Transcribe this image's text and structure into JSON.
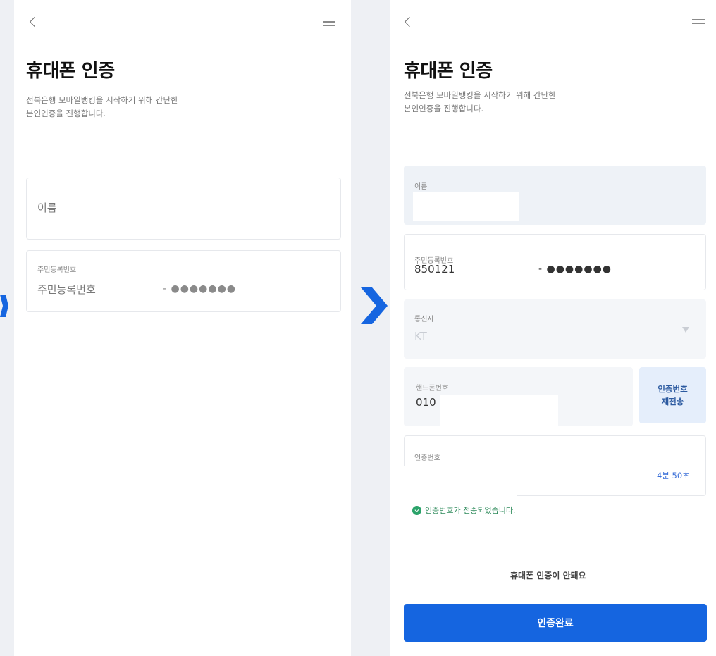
{
  "left": {
    "title": "휴대폰 인증",
    "description_line1": "전북은행 모바일뱅킹을 시작하기 위해 간단한",
    "description_line2": "본인인증을 진행합니다.",
    "name_placeholder": "이름",
    "rrn_label": "주민등록번호",
    "rrn_placeholder": "주민등록번호",
    "rrn_mask": "- ●●●●●●●"
  },
  "right": {
    "title": "휴대폰 인증",
    "description_line1": "전북은행 모바일뱅킹을 시작하기 위해 간단한",
    "description_line2": "본인인증을 진행합니다.",
    "name_label": "이름",
    "rrn_label": "주민등록번호",
    "rrn_front": "850121",
    "rrn_mask": "- ●●●●●●●",
    "carrier_label": "통신사",
    "carrier_value": "KT",
    "phone_label": "핸드폰번호",
    "phone_value": "010",
    "resend_line1": "인증번호",
    "resend_line2": "재전송",
    "code_label": "인증번호",
    "timer": "4분 50초",
    "sent_message": "인증번호가 전송되었습니다.",
    "help_link": "휴대폰 인증이 안돼요",
    "complete_button": "인증완료"
  },
  "colors": {
    "primary": "#1565e0",
    "arrow": "#1565e0",
    "success": "#2ba36a"
  }
}
